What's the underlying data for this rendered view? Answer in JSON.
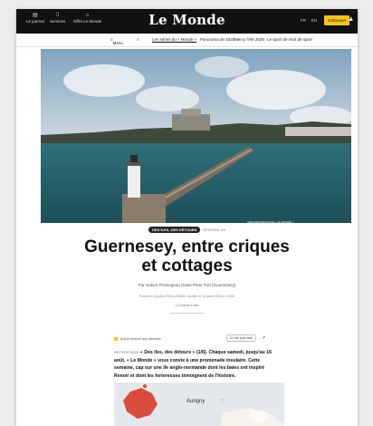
{
  "topbar": {
    "le_journal": "Le journal",
    "services": "Services",
    "offre": "Offre Le Monde",
    "logo": "Le Monde",
    "lang_fr": "FR",
    "lang_en": "EN",
    "abonner": "S'abonner"
  },
  "subnav": {
    "menu": "Menu",
    "items": [
      "Les séries du « Monde »",
      "Panorama de 2025",
      "Mercy l'été 2025",
      "Le sport de récit de sport"
    ]
  },
  "hero": {
    "credit": "ANNA BROWN POUR « LE MONDE »"
  },
  "article": {
    "tag": "DES ÎLES, DES DÉTOURS",
    "episode": "ÉPISODE 1/6",
    "title_line1": "Guernesey, entre criques",
    "title_line2": "et cottages",
    "byline": "Par Hubert Prolongeau (Saint Peter Port [Guernesey])",
    "dateline": "Publié le 16 juillet 2025 à 05h00, modifié le 16 juillet 2025 à 10h50",
    "readtime": "Lecture 4 min",
    "premium_label": "Article réservé aux abonnés",
    "read_later": "Lire plus tard",
    "chapo_kicker": "REPORTAGE",
    "chapo_text": "« Des îles, des détours » (1/6). Chaque samedi, jusqu'au 16 août, « Le Monde » vous convie à une promenade insulaire. Cette semaine, cap sur une île anglo-normande dont les baies ont inspiré Renoir et dont les forteresses témoignent de l'histoire.",
    "map_label": "Aurigny"
  },
  "colors": {
    "accent": "#f5c518",
    "topbar": "#111111"
  }
}
